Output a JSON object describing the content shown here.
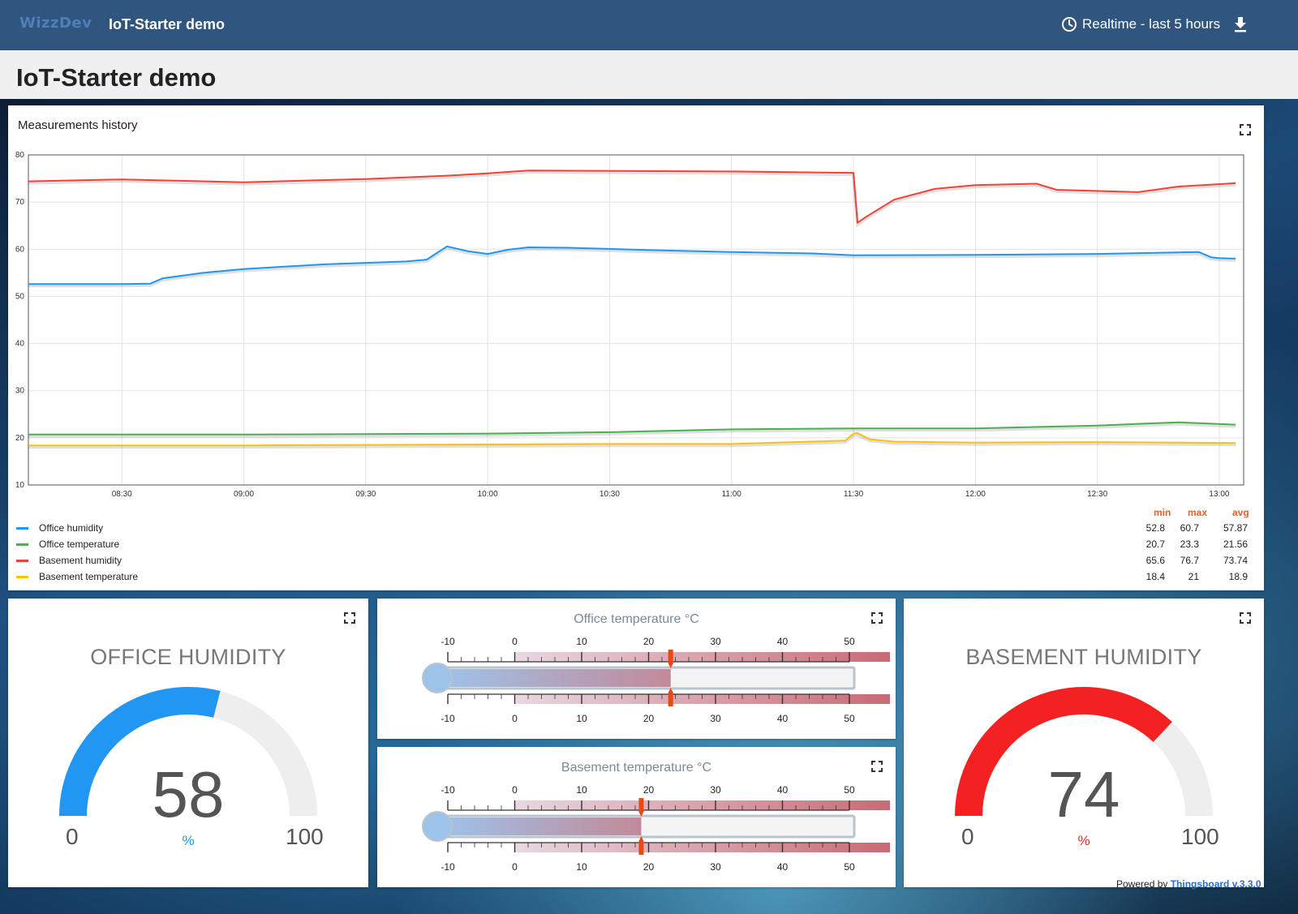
{
  "toolbar": {
    "logo_text": "WizzDev",
    "app_title": "IoT-Starter demo",
    "timewindow_label": "Realtime - last 5 hours",
    "clock_icon": "clock-icon",
    "download_icon": "download-icon"
  },
  "dashboard": {
    "title": "IoT-Starter demo"
  },
  "history_widget": {
    "title": "Measurements history",
    "legend_headers": {
      "min": "min",
      "max": "max",
      "avg": "avg"
    },
    "legend": [
      {
        "name": "Office humidity",
        "color": "#2196f3",
        "min": "52.8",
        "max": "60.7",
        "avg": "57.87"
      },
      {
        "name": "Office temperature",
        "color": "#4caf50",
        "min": "20.7",
        "max": "23.3",
        "avg": "21.56"
      },
      {
        "name": "Basement humidity",
        "color": "#f44336",
        "min": "65.6",
        "max": "76.7",
        "avg": "73.74"
      },
      {
        "name": "Basement temperature",
        "color": "#ffc107",
        "min": "18.4",
        "max": "21",
        "avg": "18.9"
      }
    ]
  },
  "chart_data": {
    "type": "line",
    "title": "Measurements history",
    "xlabel": "",
    "ylabel": "",
    "ylim": [
      10,
      80
    ],
    "yticks": [
      "10",
      "20",
      "30",
      "40",
      "50",
      "60",
      "70",
      "80"
    ],
    "xticks": [
      "08:30",
      "09:00",
      "09:30",
      "10:00",
      "10:30",
      "11:00",
      "11:30",
      "12:00",
      "12:30",
      "13:00"
    ],
    "x_range": [
      "08:07",
      "13:06"
    ],
    "grid": true,
    "legend_position": "bottom",
    "series": [
      {
        "name": "Office humidity",
        "color": "#2196f3",
        "x": [
          "08:07",
          "08:30",
          "08:37",
          "08:40",
          "08:50",
          "09:00",
          "09:10",
          "09:20",
          "09:30",
          "09:40",
          "09:45",
          "09:50",
          "09:55",
          "10:00",
          "10:05",
          "10:10",
          "10:20",
          "10:40",
          "11:00",
          "11:20",
          "11:30",
          "12:00",
          "12:30",
          "12:55",
          "12:58",
          "13:00",
          "13:04"
        ],
        "values": [
          52.6,
          52.6,
          52.7,
          53.8,
          55.0,
          55.8,
          56.3,
          56.8,
          57.1,
          57.4,
          57.8,
          60.6,
          59.6,
          59.0,
          59.9,
          60.4,
          60.3,
          59.8,
          59.4,
          59.1,
          58.7,
          58.8,
          59.0,
          59.4,
          58.3,
          58.1,
          58.0
        ]
      },
      {
        "name": "Office temperature",
        "color": "#4caf50",
        "x": [
          "08:07",
          "09:00",
          "10:00",
          "10:30",
          "11:00",
          "11:30",
          "12:00",
          "12:30",
          "12:50",
          "13:04"
        ],
        "values": [
          20.7,
          20.7,
          20.9,
          21.2,
          21.8,
          22.0,
          22.0,
          22.6,
          23.3,
          22.8
        ]
      },
      {
        "name": "Basement humidity",
        "color": "#f44336",
        "x": [
          "08:07",
          "08:30",
          "09:00",
          "09:30",
          "09:50",
          "10:00",
          "10:10",
          "11:00",
          "11:30",
          "11:31",
          "11:33",
          "11:40",
          "11:50",
          "12:00",
          "12:15",
          "12:20",
          "12:40",
          "12:50",
          "13:04"
        ],
        "values": [
          74.4,
          74.8,
          74.2,
          74.9,
          75.6,
          76.1,
          76.7,
          76.5,
          76.2,
          65.6,
          66.8,
          70.5,
          72.8,
          73.6,
          73.9,
          72.6,
          72.1,
          73.3,
          74.0
        ]
      },
      {
        "name": "Basement temperature",
        "color": "#ffc107",
        "x": [
          "08:07",
          "09:00",
          "09:30",
          "10:00",
          "10:30",
          "11:00",
          "11:28",
          "11:30",
          "11:31",
          "11:34",
          "11:40",
          "12:00",
          "12:30",
          "13:04"
        ],
        "values": [
          18.4,
          18.4,
          18.5,
          18.6,
          18.7,
          18.7,
          19.4,
          20.9,
          21.0,
          19.7,
          19.2,
          19.0,
          19.1,
          18.9
        ]
      }
    ]
  },
  "office_humidity_gauge": {
    "title": "OFFICE HUMIDITY",
    "value": "58",
    "value_number": 58,
    "min": "0",
    "max": "100",
    "unit": "%",
    "color": "#2196f3",
    "track_color": "#eeeeee"
  },
  "basement_humidity_gauge": {
    "title": "BASEMENT HUMIDITY",
    "value": "74",
    "value_number": 74,
    "min": "0",
    "max": "100",
    "unit": "%",
    "color": "#f32121",
    "track_color": "#eeeeee"
  },
  "office_temp_thermometer": {
    "title": "Office temperature °C",
    "value": 23.3,
    "scale_min": -10,
    "scale_max": 55,
    "tick_labels": [
      "-10",
      "0",
      "10",
      "20",
      "30",
      "40",
      "50"
    ]
  },
  "basement_temp_thermometer": {
    "title": "Basement temperature °C",
    "value": 18.9,
    "scale_min": -10,
    "scale_max": 55,
    "tick_labels": [
      "-10",
      "0",
      "10",
      "20",
      "30",
      "40",
      "50"
    ]
  },
  "footer": {
    "powered_by": "Powered by",
    "platform_link": "Thingsboard v.3.3.0"
  }
}
